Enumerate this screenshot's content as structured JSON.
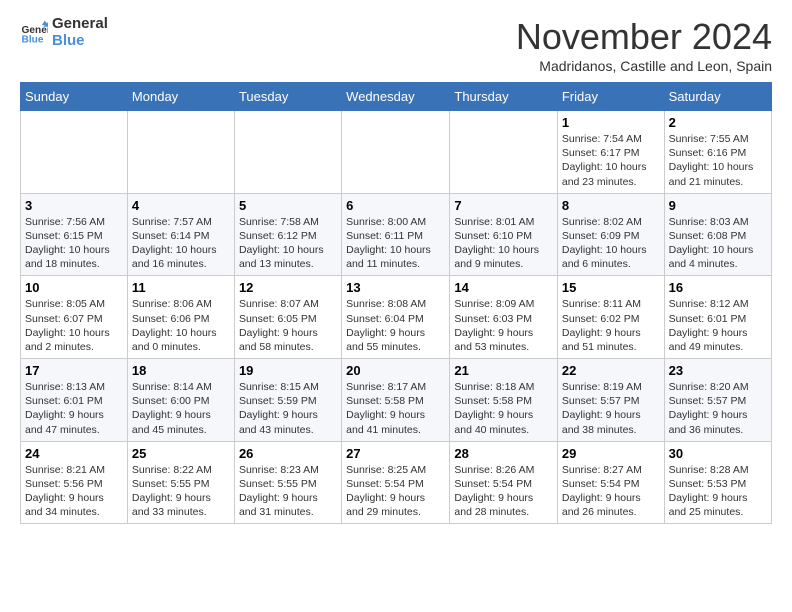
{
  "logo": {
    "line1": "General",
    "line2": "Blue"
  },
  "title": "November 2024",
  "location": "Madridanos, Castille and Leon, Spain",
  "days_of_week": [
    "Sunday",
    "Monday",
    "Tuesday",
    "Wednesday",
    "Thursday",
    "Friday",
    "Saturday"
  ],
  "weeks": [
    [
      {
        "day": "",
        "info": ""
      },
      {
        "day": "",
        "info": ""
      },
      {
        "day": "",
        "info": ""
      },
      {
        "day": "",
        "info": ""
      },
      {
        "day": "",
        "info": ""
      },
      {
        "day": "1",
        "info": "Sunrise: 7:54 AM\nSunset: 6:17 PM\nDaylight: 10 hours\nand 23 minutes."
      },
      {
        "day": "2",
        "info": "Sunrise: 7:55 AM\nSunset: 6:16 PM\nDaylight: 10 hours\nand 21 minutes."
      }
    ],
    [
      {
        "day": "3",
        "info": "Sunrise: 7:56 AM\nSunset: 6:15 PM\nDaylight: 10 hours\nand 18 minutes."
      },
      {
        "day": "4",
        "info": "Sunrise: 7:57 AM\nSunset: 6:14 PM\nDaylight: 10 hours\nand 16 minutes."
      },
      {
        "day": "5",
        "info": "Sunrise: 7:58 AM\nSunset: 6:12 PM\nDaylight: 10 hours\nand 13 minutes."
      },
      {
        "day": "6",
        "info": "Sunrise: 8:00 AM\nSunset: 6:11 PM\nDaylight: 10 hours\nand 11 minutes."
      },
      {
        "day": "7",
        "info": "Sunrise: 8:01 AM\nSunset: 6:10 PM\nDaylight: 10 hours\nand 9 minutes."
      },
      {
        "day": "8",
        "info": "Sunrise: 8:02 AM\nSunset: 6:09 PM\nDaylight: 10 hours\nand 6 minutes."
      },
      {
        "day": "9",
        "info": "Sunrise: 8:03 AM\nSunset: 6:08 PM\nDaylight: 10 hours\nand 4 minutes."
      }
    ],
    [
      {
        "day": "10",
        "info": "Sunrise: 8:05 AM\nSunset: 6:07 PM\nDaylight: 10 hours\nand 2 minutes."
      },
      {
        "day": "11",
        "info": "Sunrise: 8:06 AM\nSunset: 6:06 PM\nDaylight: 10 hours\nand 0 minutes."
      },
      {
        "day": "12",
        "info": "Sunrise: 8:07 AM\nSunset: 6:05 PM\nDaylight: 9 hours\nand 58 minutes."
      },
      {
        "day": "13",
        "info": "Sunrise: 8:08 AM\nSunset: 6:04 PM\nDaylight: 9 hours\nand 55 minutes."
      },
      {
        "day": "14",
        "info": "Sunrise: 8:09 AM\nSunset: 6:03 PM\nDaylight: 9 hours\nand 53 minutes."
      },
      {
        "day": "15",
        "info": "Sunrise: 8:11 AM\nSunset: 6:02 PM\nDaylight: 9 hours\nand 51 minutes."
      },
      {
        "day": "16",
        "info": "Sunrise: 8:12 AM\nSunset: 6:01 PM\nDaylight: 9 hours\nand 49 minutes."
      }
    ],
    [
      {
        "day": "17",
        "info": "Sunrise: 8:13 AM\nSunset: 6:01 PM\nDaylight: 9 hours\nand 47 minutes."
      },
      {
        "day": "18",
        "info": "Sunrise: 8:14 AM\nSunset: 6:00 PM\nDaylight: 9 hours\nand 45 minutes."
      },
      {
        "day": "19",
        "info": "Sunrise: 8:15 AM\nSunset: 5:59 PM\nDaylight: 9 hours\nand 43 minutes."
      },
      {
        "day": "20",
        "info": "Sunrise: 8:17 AM\nSunset: 5:58 PM\nDaylight: 9 hours\nand 41 minutes."
      },
      {
        "day": "21",
        "info": "Sunrise: 8:18 AM\nSunset: 5:58 PM\nDaylight: 9 hours\nand 40 minutes."
      },
      {
        "day": "22",
        "info": "Sunrise: 8:19 AM\nSunset: 5:57 PM\nDaylight: 9 hours\nand 38 minutes."
      },
      {
        "day": "23",
        "info": "Sunrise: 8:20 AM\nSunset: 5:57 PM\nDaylight: 9 hours\nand 36 minutes."
      }
    ],
    [
      {
        "day": "24",
        "info": "Sunrise: 8:21 AM\nSunset: 5:56 PM\nDaylight: 9 hours\nand 34 minutes."
      },
      {
        "day": "25",
        "info": "Sunrise: 8:22 AM\nSunset: 5:55 PM\nDaylight: 9 hours\nand 33 minutes."
      },
      {
        "day": "26",
        "info": "Sunrise: 8:23 AM\nSunset: 5:55 PM\nDaylight: 9 hours\nand 31 minutes."
      },
      {
        "day": "27",
        "info": "Sunrise: 8:25 AM\nSunset: 5:54 PM\nDaylight: 9 hours\nand 29 minutes."
      },
      {
        "day": "28",
        "info": "Sunrise: 8:26 AM\nSunset: 5:54 PM\nDaylight: 9 hours\nand 28 minutes."
      },
      {
        "day": "29",
        "info": "Sunrise: 8:27 AM\nSunset: 5:54 PM\nDaylight: 9 hours\nand 26 minutes."
      },
      {
        "day": "30",
        "info": "Sunrise: 8:28 AM\nSunset: 5:53 PM\nDaylight: 9 hours\nand 25 minutes."
      }
    ]
  ]
}
